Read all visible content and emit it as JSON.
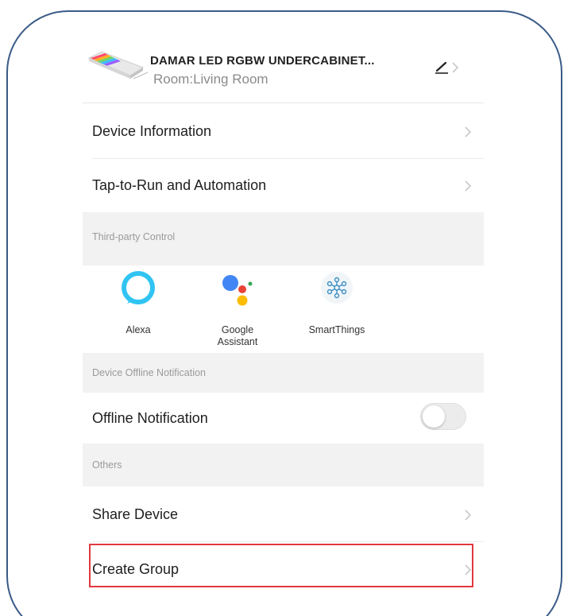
{
  "header": {
    "device_name": "DAMAR LED RGBW UNDERCABINET...",
    "room": "Room:Living Room"
  },
  "menu": {
    "device_information": "Device Information",
    "tap_to_run": "Tap-to-Run and Automation"
  },
  "third_party": {
    "section_title": "Third-party Control",
    "items": [
      {
        "label": "Alexa",
        "icon": "alexa-icon"
      },
      {
        "label": "Google\nAssistant",
        "icon": "google-assistant-icon"
      },
      {
        "label": "SmartThings",
        "icon": "smartthings-icon"
      }
    ]
  },
  "offline": {
    "section_title": "Device Offline Notification",
    "label": "Offline Notification",
    "enabled": false
  },
  "others": {
    "section_title": "Others",
    "share_device": "Share Device",
    "create_group": "Create Group"
  },
  "colors": {
    "frame_border": "#3a5a86",
    "highlight": "#e0393e",
    "alexa": "#31c4f3",
    "google_blue": "#4285f4",
    "google_red": "#ea4335",
    "google_yellow": "#fbbc05",
    "google_green": "#34a853"
  }
}
